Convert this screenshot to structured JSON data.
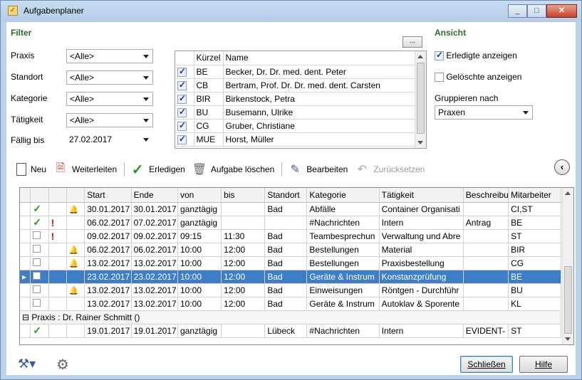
{
  "window": {
    "title": "Aufgabenplaner"
  },
  "filter": {
    "title": "Filter",
    "rows": [
      {
        "label": "Praxis",
        "value": "<Alle>"
      },
      {
        "label": "Standort",
        "value": "<Alle>"
      },
      {
        "label": "Kategorie",
        "value": "<Alle>"
      },
      {
        "label": "Tätigkeit",
        "value": "<Alle>"
      }
    ],
    "due_label": "Fällig bis",
    "due_value": "27.02.2017",
    "more_button": "...",
    "list_header": {
      "code": "Kürzel",
      "name": "Name"
    },
    "employees": [
      {
        "code": "BE",
        "name": "Becker, Dr. Dr. med. dent. Peter"
      },
      {
        "code": "CB",
        "name": "Bertram, Prof. Dr. Dr. med. dent. Carsten"
      },
      {
        "code": "BIR",
        "name": "Birkenstock, Petra"
      },
      {
        "code": "BU",
        "name": "Busemann, Ulrike"
      },
      {
        "code": "CG",
        "name": "Gruber, Christiane"
      },
      {
        "code": "MUE",
        "name": "Horst, Müller"
      }
    ]
  },
  "view": {
    "title": "Ansicht",
    "show_done": "Erledigte anzeigen",
    "show_deleted": "Gelöschte anzeigen",
    "group_label": "Gruppieren nach",
    "group_value": "Praxen"
  },
  "toolbar": {
    "new": "Neu",
    "forward": "Weiterleiten",
    "complete": "Erledigen",
    "delete": "Aufgabe löschen",
    "edit": "Bearbeiten",
    "reset": "Zurücksetzen"
  },
  "grid": {
    "columns": [
      "Start",
      "Ende",
      "von",
      "bis",
      "Standort",
      "Kategorie",
      "Tätigkeit",
      "Beschreibu",
      "Mitarbeiter"
    ],
    "rows": [
      {
        "done": true,
        "urgent": false,
        "bell": true,
        "start": "30.01.2017",
        "end": "30.01.2017",
        "from": "ganztägig",
        "to": "",
        "loc": "Bad",
        "cat": "Abfälle",
        "act": "Container Organisati",
        "desc": "",
        "staff": "CI,ST"
      },
      {
        "done": true,
        "urgent": true,
        "bell": false,
        "start": "06.02.2017",
        "end": "07.02.2017",
        "from": "ganztägig",
        "to": "",
        "loc": "",
        "cat": "#Nachrichten",
        "act": "Intern",
        "desc": "Antrag",
        "staff": "BE"
      },
      {
        "done": false,
        "urgent": true,
        "bell": false,
        "start": "09.02.2017",
        "end": "09.02.2017",
        "from": "09:15",
        "to": "11:30",
        "loc": "Bad",
        "cat": "Teambesprechun",
        "act": "Verwaltung und Abre",
        "desc": "",
        "staff": "ST"
      },
      {
        "done": false,
        "urgent": false,
        "bell": true,
        "start": "06.02.2017",
        "end": "06.02.2017",
        "from": "10:00",
        "to": "12:00",
        "loc": "Bad",
        "cat": "Bestellungen",
        "act": "Material",
        "desc": "",
        "staff": "BIR"
      },
      {
        "done": false,
        "urgent": false,
        "bell": true,
        "start": "13.02.2017",
        "end": "13.02.2017",
        "from": "10:00",
        "to": "12:00",
        "loc": "Bad",
        "cat": "Bestellungen",
        "act": "Praxisbestellung",
        "desc": "",
        "staff": "CG"
      },
      {
        "done": false,
        "urgent": false,
        "bell": false,
        "selected": true,
        "start": "23.02.2017",
        "end": "23.02.2017",
        "from": "10:00",
        "to": "12:00",
        "loc": "Bad",
        "cat": "Geräte & Instrum",
        "act": "Konstanzprüfung",
        "desc": "",
        "staff": "BE"
      },
      {
        "done": false,
        "urgent": false,
        "bell": true,
        "start": "13.02.2017",
        "end": "13.02.2017",
        "from": "10:00",
        "to": "12:00",
        "loc": "Bad",
        "cat": "Einweisungen",
        "act": "Röntgen - Durchführ",
        "desc": "",
        "staff": "BU"
      },
      {
        "done": false,
        "urgent": false,
        "bell": false,
        "start": "13.02.2017",
        "end": "13.02.2017",
        "from": "10:00",
        "to": "12:00",
        "loc": "Bad",
        "cat": "Geräte & Instrum",
        "act": "Autoklav & Sporente",
        "desc": "",
        "staff": "KL"
      }
    ],
    "group_label": "Praxis : Dr. Rainer Schmitt ()",
    "group_rows": [
      {
        "done": true,
        "urgent": false,
        "bell": false,
        "start": "19.01.2017",
        "end": "19.01.2017",
        "from": "ganztägig",
        "to": "",
        "loc": "Lübeck",
        "cat": "#Nachrichten",
        "act": "Intern",
        "desc": "EVIDENT-",
        "staff": "ST"
      }
    ]
  },
  "footer": {
    "close": "Schließen",
    "help": "Hilfe"
  }
}
